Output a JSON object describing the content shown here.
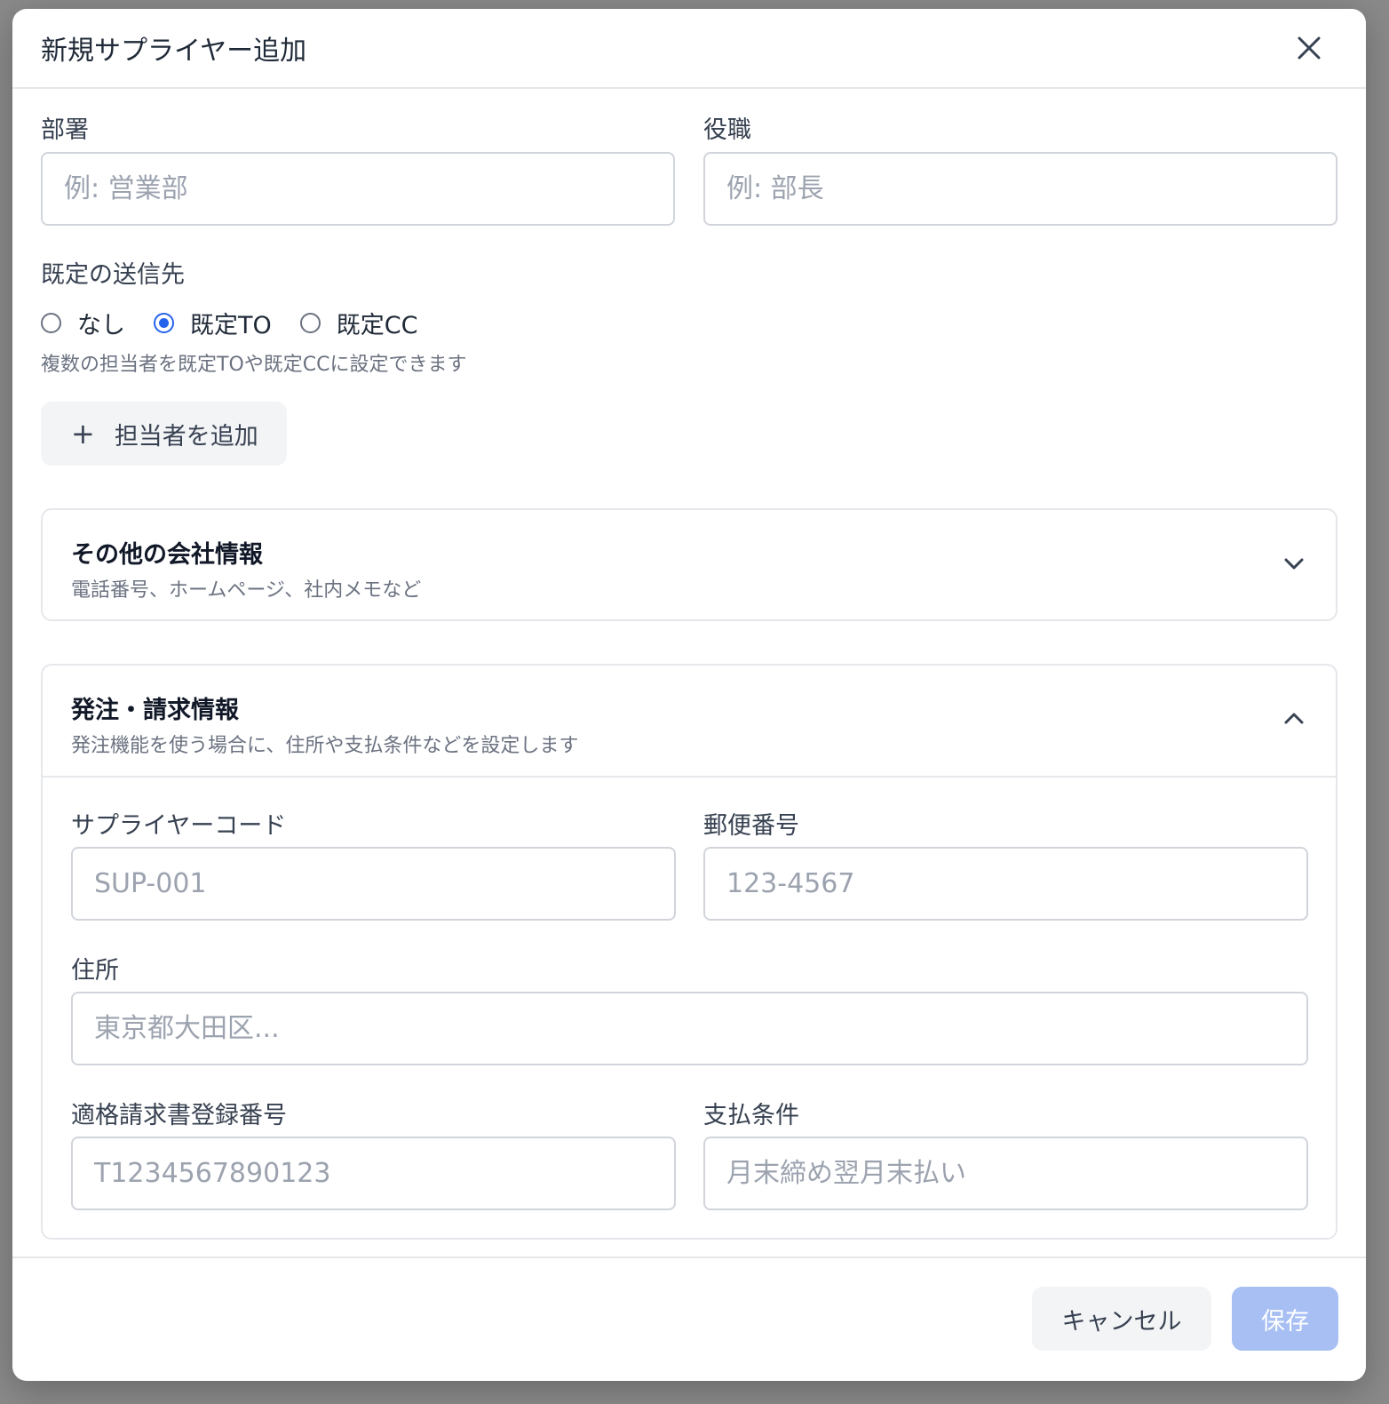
{
  "modal": {
    "title": "新規サプライヤー追加"
  },
  "contact": {
    "department_label": "部署",
    "department_placeholder": "例: 営業部",
    "position_label": "役職",
    "position_placeholder": "例: 部長",
    "default_recipient_label": "既定の送信先",
    "recipient_options": [
      {
        "label": "なし",
        "checked": false
      },
      {
        "label": "既定TO",
        "checked": true
      },
      {
        "label": "既定CC",
        "checked": false
      }
    ],
    "recipient_hint": "複数の担当者を既定TOや既定CCに設定できます",
    "add_contact_label": "担当者を追加"
  },
  "other_info": {
    "title": "その他の会社情報",
    "subtitle": "電話番号、ホームページ、社内メモなど",
    "expanded": false
  },
  "order_info": {
    "title": "発注・請求情報",
    "subtitle": "発注機能を使う場合に、住所や支払条件などを設定します",
    "expanded": true,
    "supplier_code_label": "サプライヤーコード",
    "supplier_code_placeholder": "SUP-001",
    "postal_code_label": "郵便番号",
    "postal_code_placeholder": "123-4567",
    "address_label": "住所",
    "address_placeholder": "東京都大田区...",
    "invoice_number_label": "適格請求書登録番号",
    "invoice_number_placeholder": "T1234567890123",
    "payment_terms_label": "支払条件",
    "payment_terms_placeholder": "月末締め翌月末払い"
  },
  "footer": {
    "cancel_label": "キャンセル",
    "save_label": "保存"
  },
  "colors": {
    "accent": "#2563eb",
    "save_disabled": "#a7bff3",
    "border": "#d1d5db"
  }
}
